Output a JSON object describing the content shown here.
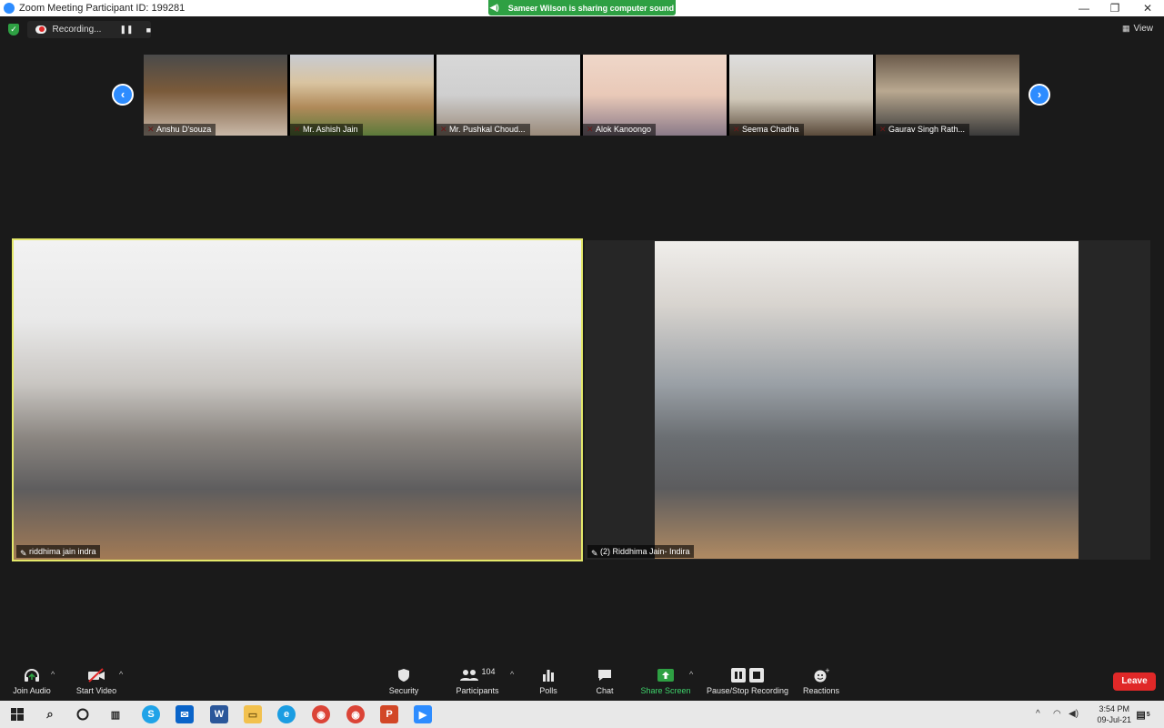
{
  "window": {
    "title": "Zoom Meeting Participant ID: 199281",
    "min": "—",
    "restore": "❐",
    "close": "✕"
  },
  "share_banner": "Sameer Wilson is sharing computer sound",
  "recording": {
    "label": "Recording...",
    "pause": "❚❚",
    "stop": "■"
  },
  "view_label": "View",
  "participants_strip": [
    {
      "name": "Anshu D'souza"
    },
    {
      "name": "Mr. Ashish Jain"
    },
    {
      "name": "Mr. Pushkal Choud..."
    },
    {
      "name": "Alok Kanoongo"
    },
    {
      "name": "Seema Chadha"
    },
    {
      "name": "Gaurav Singh Rath..."
    }
  ],
  "main_videos": [
    {
      "name": "riddhima jain indra"
    },
    {
      "name": "(2) Riddhima Jain- Indira"
    }
  ],
  "toolbar": {
    "join_audio": "Join Audio",
    "start_video": "Start Video",
    "security": "Security",
    "participants": "Participants",
    "participants_count": "104",
    "polls": "Polls",
    "chat": "Chat",
    "share_screen": "Share Screen",
    "recording": "Pause/Stop Recording",
    "reactions": "Reactions",
    "leave": "Leave"
  },
  "taskbar": {
    "time": "3:54 PM",
    "date": "09-Jul-21",
    "notification_count": "5"
  },
  "colors": {
    "accent": "#2d8cff",
    "active_speaker_border": "#e4e86a",
    "share_green": "#2ea043",
    "leave_red": "#e02828"
  }
}
